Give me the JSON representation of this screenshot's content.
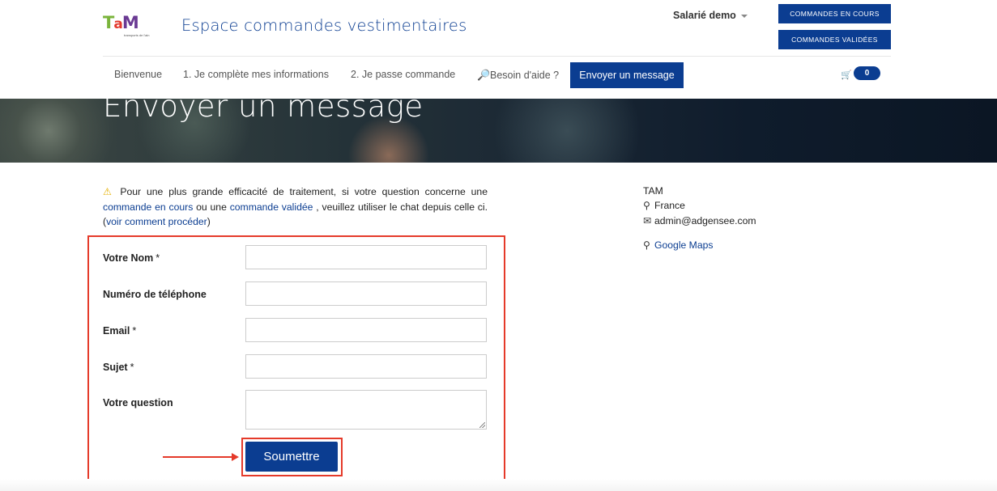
{
  "header": {
    "logo_text_t": "T",
    "logo_text_a": "a",
    "logo_text_m": "M",
    "logo_sub": "transports de l'ain",
    "site_title": "Espace commandes vestimentaires",
    "user_label": "Salarié demo",
    "btn_orders_current": "Commandes en cours",
    "btn_orders_validated": "Commandes validées"
  },
  "nav": {
    "items": [
      {
        "label": "Bienvenue"
      },
      {
        "label": "1. Je complète mes informations"
      },
      {
        "label": "2. Je passe commande"
      },
      {
        "label": "Besoin d'aide ?"
      }
    ],
    "active": "Envoyer un message",
    "cart_count": "0"
  },
  "hero": {
    "title": "Envoyer un message"
  },
  "notice": {
    "text1": "Pour une plus grande efficacité de traitement, si votre question concerne une",
    "link1": "commande en cours",
    "text2": "ou une",
    "link2": "commande validée",
    "text3": ", veuillez utiliser le chat depuis celle ci. (",
    "link3": "voir comment procéder",
    "text4": ")"
  },
  "form": {
    "fields": [
      {
        "label": "Votre Nom",
        "required": "*",
        "value": ""
      },
      {
        "label": "Numéro de téléphone",
        "required": "",
        "value": ""
      },
      {
        "label": "Email",
        "required": "*",
        "value": ""
      },
      {
        "label": "Sujet",
        "required": "*",
        "value": ""
      },
      {
        "label": "Votre question",
        "required": "",
        "value": ""
      }
    ],
    "submit": "Soumettre"
  },
  "contact": {
    "name": "TAM",
    "country": "France",
    "email": "admin@adgensee.com",
    "maps": "Google Maps"
  },
  "colors": {
    "brand": "#0b3d91",
    "highlight": "#e53a2a"
  }
}
